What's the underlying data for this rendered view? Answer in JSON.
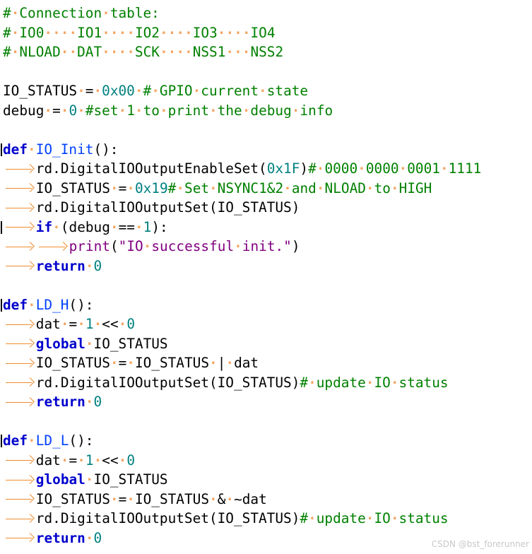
{
  "watermark": "CSDN @bst_forerunner",
  "code_lines": [
    [
      [
        "c",
        "#"
      ],
      [
        "s"
      ],
      [
        "c",
        "Connection"
      ],
      [
        "s"
      ],
      [
        "c",
        "table:"
      ]
    ],
    [
      [
        "c",
        "#"
      ],
      [
        "s"
      ],
      [
        "c",
        "IO0"
      ],
      [
        "s"
      ],
      [
        "s"
      ],
      [
        "s"
      ],
      [
        "s"
      ],
      [
        "c",
        "IO1"
      ],
      [
        "s"
      ],
      [
        "s"
      ],
      [
        "s"
      ],
      [
        "s"
      ],
      [
        "c",
        "IO2"
      ],
      [
        "s"
      ],
      [
        "s"
      ],
      [
        "s"
      ],
      [
        "s"
      ],
      [
        "c",
        "IO3"
      ],
      [
        "s"
      ],
      [
        "s"
      ],
      [
        "s"
      ],
      [
        "s"
      ],
      [
        "c",
        "IO4"
      ]
    ],
    [
      [
        "c",
        "#"
      ],
      [
        "s"
      ],
      [
        "c",
        "NLOAD"
      ],
      [
        "s"
      ],
      [
        "s"
      ],
      [
        "c",
        "DAT"
      ],
      [
        "s"
      ],
      [
        "s"
      ],
      [
        "s"
      ],
      [
        "s"
      ],
      [
        "c",
        "SCK"
      ],
      [
        "s"
      ],
      [
        "s"
      ],
      [
        "s"
      ],
      [
        "s"
      ],
      [
        "c",
        "NSS1"
      ],
      [
        "s"
      ],
      [
        "s"
      ],
      [
        "s"
      ],
      [
        "c",
        "NSS2"
      ]
    ],
    [],
    [
      [
        "p",
        "IO_STATUS"
      ],
      [
        "s"
      ],
      [
        "o",
        "="
      ],
      [
        "s"
      ],
      [
        "n",
        "0x00"
      ],
      [
        "s"
      ],
      [
        "c",
        "#"
      ],
      [
        "s"
      ],
      [
        "c",
        "GPIO"
      ],
      [
        "s"
      ],
      [
        "c",
        "current"
      ],
      [
        "s"
      ],
      [
        "c",
        "state"
      ]
    ],
    [
      [
        "p",
        "debug"
      ],
      [
        "s"
      ],
      [
        "o",
        "="
      ],
      [
        "s"
      ],
      [
        "n",
        "0"
      ],
      [
        "s"
      ],
      [
        "c",
        "#set"
      ],
      [
        "s"
      ],
      [
        "c",
        "1"
      ],
      [
        "s"
      ],
      [
        "c",
        "to"
      ],
      [
        "s"
      ],
      [
        "c",
        "print"
      ],
      [
        "s"
      ],
      [
        "c",
        "the"
      ],
      [
        "s"
      ],
      [
        "c",
        "debug"
      ],
      [
        "s"
      ],
      [
        "c",
        "info"
      ]
    ],
    [],
    [
      [
        "k",
        "def"
      ],
      [
        "s"
      ],
      [
        "f",
        "IO_Init"
      ],
      [
        "p",
        "():"
      ]
    ],
    [
      [
        "t"
      ],
      [
        "p",
        "rd.DigitalIOOutputEnableSet("
      ],
      [
        "n",
        "0x1F"
      ],
      [
        "p",
        ")"
      ],
      [
        "c",
        "#"
      ],
      [
        "s"
      ],
      [
        "c",
        "0000"
      ],
      [
        "s"
      ],
      [
        "c",
        "0000"
      ],
      [
        "s"
      ],
      [
        "c",
        "0001"
      ],
      [
        "s"
      ],
      [
        "c",
        "1111"
      ]
    ],
    [
      [
        "t"
      ],
      [
        "p",
        "IO_STATUS"
      ],
      [
        "s"
      ],
      [
        "o",
        "="
      ],
      [
        "s"
      ],
      [
        "n",
        "0x19"
      ],
      [
        "c",
        "#"
      ],
      [
        "s"
      ],
      [
        "c",
        "Set"
      ],
      [
        "s"
      ],
      [
        "c",
        "NSYNC1&2"
      ],
      [
        "s"
      ],
      [
        "c",
        "and"
      ],
      [
        "s"
      ],
      [
        "c",
        "NLOAD"
      ],
      [
        "s"
      ],
      [
        "c",
        "to"
      ],
      [
        "s"
      ],
      [
        "c",
        "HIGH"
      ]
    ],
    [
      [
        "t"
      ],
      [
        "p",
        "rd.DigitalIOOutputSet(IO_STATUS)"
      ]
    ],
    [
      [
        "t"
      ],
      [
        "k",
        "if"
      ],
      [
        "s"
      ],
      [
        "p",
        "(debug"
      ],
      [
        "s"
      ],
      [
        "o",
        "=="
      ],
      [
        "s"
      ],
      [
        "n",
        "1"
      ],
      [
        "p",
        "):"
      ]
    ],
    [
      [
        "t"
      ],
      [
        "t"
      ],
      [
        "b",
        "print"
      ],
      [
        "p",
        "("
      ],
      [
        "q",
        "\"IO"
      ],
      [
        "s"
      ],
      [
        "q",
        "successful"
      ],
      [
        "s"
      ],
      [
        "q",
        "init.\""
      ],
      [
        "p",
        ")"
      ]
    ],
    [
      [
        "t"
      ],
      [
        "k",
        "return"
      ],
      [
        "s"
      ],
      [
        "n",
        "0"
      ]
    ],
    [],
    [
      [
        "k",
        "def"
      ],
      [
        "s"
      ],
      [
        "f",
        "LD_H"
      ],
      [
        "p",
        "():"
      ]
    ],
    [
      [
        "t"
      ],
      [
        "p",
        "dat"
      ],
      [
        "s"
      ],
      [
        "o",
        "="
      ],
      [
        "s"
      ],
      [
        "n",
        "1"
      ],
      [
        "s"
      ],
      [
        "o",
        "<<"
      ],
      [
        "s"
      ],
      [
        "n",
        "0"
      ]
    ],
    [
      [
        "t"
      ],
      [
        "k",
        "global"
      ],
      [
        "s"
      ],
      [
        "p",
        "IO_STATUS"
      ]
    ],
    [
      [
        "t"
      ],
      [
        "p",
        "IO_STATUS"
      ],
      [
        "s"
      ],
      [
        "o",
        "="
      ],
      [
        "s"
      ],
      [
        "p",
        "IO_STATUS"
      ],
      [
        "s"
      ],
      [
        "o",
        "|"
      ],
      [
        "s"
      ],
      [
        "p",
        "dat"
      ]
    ],
    [
      [
        "t"
      ],
      [
        "p",
        "rd.DigitalIOOutputSet(IO_STATUS)"
      ],
      [
        "c",
        "#"
      ],
      [
        "s"
      ],
      [
        "c",
        "update"
      ],
      [
        "s"
      ],
      [
        "c",
        "IO"
      ],
      [
        "s"
      ],
      [
        "c",
        "status"
      ]
    ],
    [
      [
        "t"
      ],
      [
        "k",
        "return"
      ],
      [
        "s"
      ],
      [
        "n",
        "0"
      ]
    ],
    [],
    [
      [
        "k",
        "def"
      ],
      [
        "s"
      ],
      [
        "f",
        "LD_L"
      ],
      [
        "p",
        "():"
      ]
    ],
    [
      [
        "t"
      ],
      [
        "p",
        "dat"
      ],
      [
        "s"
      ],
      [
        "o",
        "="
      ],
      [
        "s"
      ],
      [
        "n",
        "1"
      ],
      [
        "s"
      ],
      [
        "o",
        "<<"
      ],
      [
        "s"
      ],
      [
        "n",
        "0"
      ]
    ],
    [
      [
        "t"
      ],
      [
        "k",
        "global"
      ],
      [
        "s"
      ],
      [
        "p",
        "IO_STATUS"
      ]
    ],
    [
      [
        "t"
      ],
      [
        "p",
        "IO_STATUS"
      ],
      [
        "s"
      ],
      [
        "o",
        "="
      ],
      [
        "s"
      ],
      [
        "p",
        "IO_STATUS"
      ],
      [
        "s"
      ],
      [
        "o",
        "&"
      ],
      [
        "s"
      ],
      [
        "p",
        "~dat"
      ]
    ],
    [
      [
        "t"
      ],
      [
        "p",
        "rd.DigitalIOOutputSet(IO_STATUS)"
      ],
      [
        "c",
        "#"
      ],
      [
        "s"
      ],
      [
        "c",
        "update"
      ],
      [
        "s"
      ],
      [
        "c",
        "IO"
      ],
      [
        "s"
      ],
      [
        "c",
        "status"
      ]
    ],
    [
      [
        "t"
      ],
      [
        "k",
        "return"
      ],
      [
        "s"
      ],
      [
        "n",
        "0"
      ]
    ]
  ]
}
